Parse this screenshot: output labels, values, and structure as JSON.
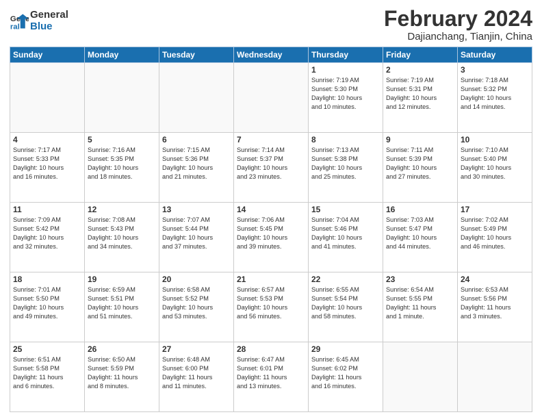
{
  "logo": {
    "line1": "General",
    "line2": "Blue"
  },
  "header": {
    "month": "February 2024",
    "location": "Dajianchang, Tianjin, China"
  },
  "weekdays": [
    "Sunday",
    "Monday",
    "Tuesday",
    "Wednesday",
    "Thursday",
    "Friday",
    "Saturday"
  ],
  "weeks": [
    [
      {
        "day": "",
        "info": ""
      },
      {
        "day": "",
        "info": ""
      },
      {
        "day": "",
        "info": ""
      },
      {
        "day": "",
        "info": ""
      },
      {
        "day": "1",
        "info": "Sunrise: 7:19 AM\nSunset: 5:30 PM\nDaylight: 10 hours\nand 10 minutes."
      },
      {
        "day": "2",
        "info": "Sunrise: 7:19 AM\nSunset: 5:31 PM\nDaylight: 10 hours\nand 12 minutes."
      },
      {
        "day": "3",
        "info": "Sunrise: 7:18 AM\nSunset: 5:32 PM\nDaylight: 10 hours\nand 14 minutes."
      }
    ],
    [
      {
        "day": "4",
        "info": "Sunrise: 7:17 AM\nSunset: 5:33 PM\nDaylight: 10 hours\nand 16 minutes."
      },
      {
        "day": "5",
        "info": "Sunrise: 7:16 AM\nSunset: 5:35 PM\nDaylight: 10 hours\nand 18 minutes."
      },
      {
        "day": "6",
        "info": "Sunrise: 7:15 AM\nSunset: 5:36 PM\nDaylight: 10 hours\nand 21 minutes."
      },
      {
        "day": "7",
        "info": "Sunrise: 7:14 AM\nSunset: 5:37 PM\nDaylight: 10 hours\nand 23 minutes."
      },
      {
        "day": "8",
        "info": "Sunrise: 7:13 AM\nSunset: 5:38 PM\nDaylight: 10 hours\nand 25 minutes."
      },
      {
        "day": "9",
        "info": "Sunrise: 7:11 AM\nSunset: 5:39 PM\nDaylight: 10 hours\nand 27 minutes."
      },
      {
        "day": "10",
        "info": "Sunrise: 7:10 AM\nSunset: 5:40 PM\nDaylight: 10 hours\nand 30 minutes."
      }
    ],
    [
      {
        "day": "11",
        "info": "Sunrise: 7:09 AM\nSunset: 5:42 PM\nDaylight: 10 hours\nand 32 minutes."
      },
      {
        "day": "12",
        "info": "Sunrise: 7:08 AM\nSunset: 5:43 PM\nDaylight: 10 hours\nand 34 minutes."
      },
      {
        "day": "13",
        "info": "Sunrise: 7:07 AM\nSunset: 5:44 PM\nDaylight: 10 hours\nand 37 minutes."
      },
      {
        "day": "14",
        "info": "Sunrise: 7:06 AM\nSunset: 5:45 PM\nDaylight: 10 hours\nand 39 minutes."
      },
      {
        "day": "15",
        "info": "Sunrise: 7:04 AM\nSunset: 5:46 PM\nDaylight: 10 hours\nand 41 minutes."
      },
      {
        "day": "16",
        "info": "Sunrise: 7:03 AM\nSunset: 5:47 PM\nDaylight: 10 hours\nand 44 minutes."
      },
      {
        "day": "17",
        "info": "Sunrise: 7:02 AM\nSunset: 5:49 PM\nDaylight: 10 hours\nand 46 minutes."
      }
    ],
    [
      {
        "day": "18",
        "info": "Sunrise: 7:01 AM\nSunset: 5:50 PM\nDaylight: 10 hours\nand 49 minutes."
      },
      {
        "day": "19",
        "info": "Sunrise: 6:59 AM\nSunset: 5:51 PM\nDaylight: 10 hours\nand 51 minutes."
      },
      {
        "day": "20",
        "info": "Sunrise: 6:58 AM\nSunset: 5:52 PM\nDaylight: 10 hours\nand 53 minutes."
      },
      {
        "day": "21",
        "info": "Sunrise: 6:57 AM\nSunset: 5:53 PM\nDaylight: 10 hours\nand 56 minutes."
      },
      {
        "day": "22",
        "info": "Sunrise: 6:55 AM\nSunset: 5:54 PM\nDaylight: 10 hours\nand 58 minutes."
      },
      {
        "day": "23",
        "info": "Sunrise: 6:54 AM\nSunset: 5:55 PM\nDaylight: 11 hours\nand 1 minute."
      },
      {
        "day": "24",
        "info": "Sunrise: 6:53 AM\nSunset: 5:56 PM\nDaylight: 11 hours\nand 3 minutes."
      }
    ],
    [
      {
        "day": "25",
        "info": "Sunrise: 6:51 AM\nSunset: 5:58 PM\nDaylight: 11 hours\nand 6 minutes."
      },
      {
        "day": "26",
        "info": "Sunrise: 6:50 AM\nSunset: 5:59 PM\nDaylight: 11 hours\nand 8 minutes."
      },
      {
        "day": "27",
        "info": "Sunrise: 6:48 AM\nSunset: 6:00 PM\nDaylight: 11 hours\nand 11 minutes."
      },
      {
        "day": "28",
        "info": "Sunrise: 6:47 AM\nSunset: 6:01 PM\nDaylight: 11 hours\nand 13 minutes."
      },
      {
        "day": "29",
        "info": "Sunrise: 6:45 AM\nSunset: 6:02 PM\nDaylight: 11 hours\nand 16 minutes."
      },
      {
        "day": "",
        "info": ""
      },
      {
        "day": "",
        "info": ""
      }
    ]
  ]
}
